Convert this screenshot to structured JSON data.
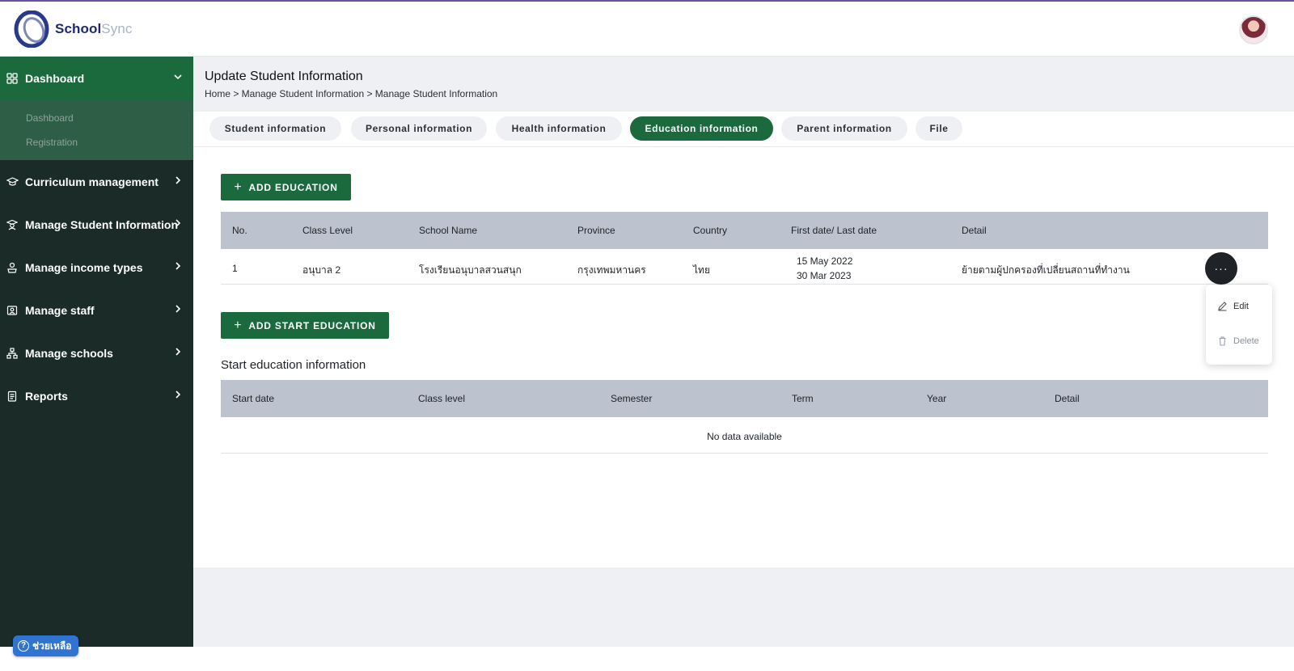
{
  "brand": {
    "name_part1": "School",
    "name_part2": "Sync",
    "primary": "#1a6a3e",
    "sidebar_bg": "#1a2b28"
  },
  "sidebar": {
    "items": [
      {
        "label": "Dashboard",
        "icon": "grid-icon",
        "expanded": true
      },
      {
        "label": "Curriculum management",
        "icon": "graduation-cap-icon"
      },
      {
        "label": "Manage Student Information",
        "icon": "student-icon"
      },
      {
        "label": "Manage income types",
        "icon": "income-icon"
      },
      {
        "label": "Manage staff",
        "icon": "staff-id-icon"
      },
      {
        "label": "Manage schools",
        "icon": "school-network-icon"
      },
      {
        "label": "Reports",
        "icon": "report-icon"
      }
    ],
    "subitems": [
      "Dashboard",
      "Registration"
    ]
  },
  "help": {
    "label": "ช่วยเหลือ"
  },
  "page": {
    "title": "Update Student Information",
    "breadcrumb": "Home > Manage Student Information > Manage Student Information"
  },
  "tabs": [
    {
      "label": "Student information"
    },
    {
      "label": "Personal information"
    },
    {
      "label": "Health information"
    },
    {
      "label": "Education information",
      "active": true
    },
    {
      "label": "Parent information"
    },
    {
      "label": "File"
    }
  ],
  "education": {
    "add_label": "ADD EDUCATION",
    "columns": [
      "No.",
      "Class Level",
      "School Name",
      "Province",
      "Country",
      "First date/ Last date",
      "Detail"
    ],
    "rows": [
      {
        "no": "1",
        "class_level": "อนุบาล 2",
        "school": "โรงเรียนอนุบาลสวนสนุก",
        "province": "กรุงเทพมหานคร",
        "country": "ไทย",
        "first_date": "15 May 2022",
        "last_date": "30 Mar 2023",
        "detail": "ย้ายตามผู้ปกครองที่เปลี่ยนสถานที่ทำงาน"
      }
    ],
    "more_label": "···"
  },
  "row_menu": {
    "edit": "Edit",
    "delete": "Delete"
  },
  "start_education": {
    "add_label": "ADD START EDUCATION",
    "title": "Start education information",
    "columns": [
      "Start date",
      "Class level",
      "Semester",
      "Term",
      "Year",
      "Detail"
    ],
    "empty": "No data available"
  }
}
